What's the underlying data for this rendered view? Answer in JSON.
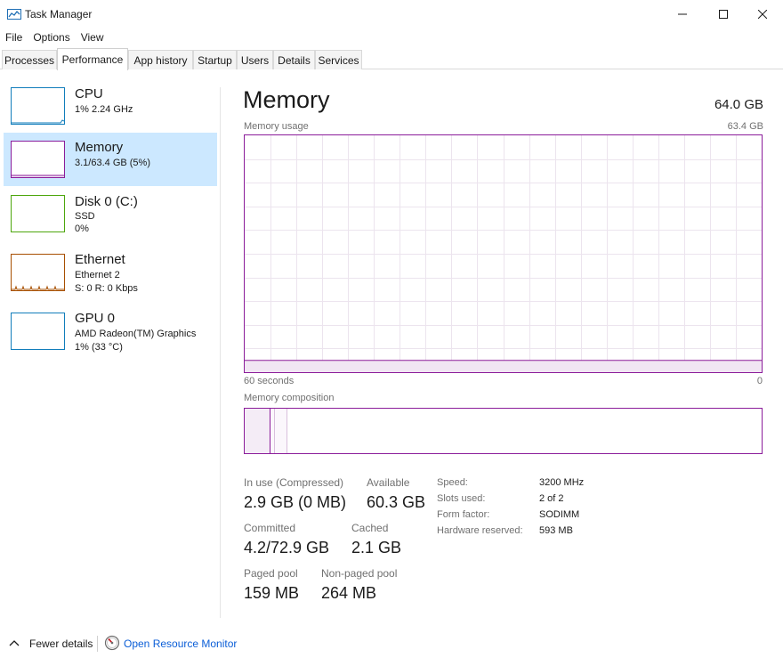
{
  "window": {
    "title": "Task Manager",
    "icon": "task-manager-icon"
  },
  "menu": [
    "File",
    "Options",
    "View"
  ],
  "tabs": [
    "Processes",
    "Performance",
    "App history",
    "Startup",
    "Users",
    "Details",
    "Services"
  ],
  "active_tab": "Performance",
  "sidebar": {
    "items": [
      {
        "name": "CPU",
        "line1": "1%  2.24 GHz",
        "line2": "",
        "color": "#117dbb"
      },
      {
        "name": "Memory",
        "line1": "3.1/63.4 GB (5%)",
        "line2": "",
        "color": "#8b1c9a"
      },
      {
        "name": "Disk 0 (C:)",
        "line1": "SSD",
        "line2": "0%",
        "color": "#4da60c"
      },
      {
        "name": "Ethernet",
        "line1": "Ethernet 2",
        "line2": "S: 0 R: 0 Kbps",
        "color": "#a74f01"
      },
      {
        "name": "GPU 0",
        "line1": "AMD Radeon(TM) Graphics",
        "line2": "1% (33 °C)",
        "color": "#117dbb"
      }
    ]
  },
  "main": {
    "title": "Memory",
    "total": "64.0 GB",
    "usage_label": "Memory usage",
    "usage_max": "63.4 GB",
    "time_left": "60 seconds",
    "time_right": "0",
    "composition_label": "Memory composition",
    "usage_percent": 5,
    "accent_color": "#8b1c9a"
  },
  "stats": {
    "in_use_label": "In use (Compressed)",
    "in_use_value": "2.9 GB (0 MB)",
    "available_label": "Available",
    "available_value": "60.3 GB",
    "committed_label": "Committed",
    "committed_value": "4.2/72.9 GB",
    "cached_label": "Cached",
    "cached_value": "2.1 GB",
    "paged_label": "Paged pool",
    "paged_value": "159 MB",
    "nonpaged_label": "Non-paged pool",
    "nonpaged_value": "264 MB"
  },
  "specs": {
    "speed_label": "Speed:",
    "speed_value": "3200 MHz",
    "slots_label": "Slots used:",
    "slots_value": "2 of 2",
    "form_label": "Form factor:",
    "form_value": "SODIMM",
    "reserved_label": "Hardware reserved:",
    "reserved_value": "593 MB"
  },
  "footer": {
    "fewer_details": "Fewer details",
    "resource_monitor": "Open Resource Monitor"
  }
}
